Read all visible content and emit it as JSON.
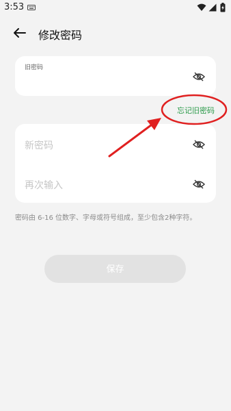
{
  "status_bar": {
    "time": "3:53",
    "icons": [
      "keyboard-icon",
      "wifi-icon",
      "signal-icon",
      "battery-charging-icon"
    ]
  },
  "header": {
    "back_icon": "arrow-left-icon",
    "title": "修改密码"
  },
  "old_password": {
    "label": "旧密码",
    "value": "",
    "visibility_icon": "eye-off-icon"
  },
  "forgot_link": "忘记旧密码",
  "new_password": {
    "placeholder": "新密码",
    "visibility_icon": "eye-off-icon"
  },
  "repeat_password": {
    "placeholder": "再次输入",
    "visibility_icon": "eye-off-icon"
  },
  "hint": "密码由 6-16 位数字、字母或符号组成，至少包含2种字符。",
  "save_button": "保存",
  "colors": {
    "accent_green": "#2a9a49",
    "annotation_red": "#e02020",
    "background": "#f3f3f3",
    "button_disabled": "#e2e2e2"
  }
}
